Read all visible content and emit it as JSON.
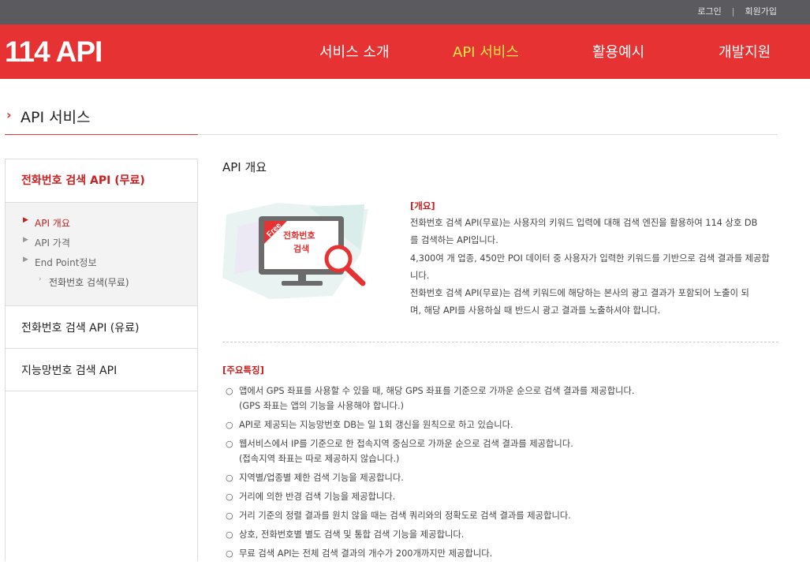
{
  "topbar": {
    "login": "로그인",
    "signup": "회원가입"
  },
  "header": {
    "logo": "114 API",
    "nav": [
      "서비스 소개",
      "API 서비스",
      "활용예시",
      "개발지원"
    ],
    "active_index": 1
  },
  "page_title": "API 서비스",
  "sidebar": {
    "head": "전화번호 검색 API (무료)",
    "sub_items": [
      "API 개요",
      "API 가격",
      "End Point정보",
      "전화번호 검색(무료)"
    ],
    "items": [
      "전화번호 검색 API (유료)",
      "지능망번호 검색 API"
    ]
  },
  "main": {
    "section_title": "API 개요",
    "illustration": {
      "badge": "Free",
      "line1": "전화번호",
      "line2": "검색"
    },
    "overview_tag": "[개요]",
    "overview_lines": [
      "전화번호 검색 API(무료)는 사용자의 키워드 입력에 대해 검색 엔진을 활용하여 114 상호 DB",
      "를 검색하는 API입니다.",
      "4,300여 개 업종, 450만 POI 데이터 중 사용자가 입력한 키워드를 기반으로 검색 결과를 제공합",
      "니다.",
      "전화번호 검색 API(무료)는 검색 키워드에 해당하는 본사의 광고 결과가 포함되어 노출이 되",
      "며, 해당 API를 사용하실 때 반드시 광고 결과를 노출하셔야 합니다."
    ],
    "features_tag": "[주요특징]",
    "features": [
      {
        "text": "앱에서 GPS 좌표를 사용할 수 있을 때, 해당 GPS 좌표를 기준으로 가까운 순으로 검색 결과를 제공합니다.",
        "sub": "(GPS 좌표는 앱의 기능을 사용해야 합니다.)"
      },
      {
        "text": "API로 제공되는 지능망번호 DB는 일 1회 갱신을 원칙으로 하고 있습니다.",
        "sub": ""
      },
      {
        "text": "웹서비스에서 IP를 기준으로 한 접속지역 중심으로 가까운 순으로 검색 결과를 제공합니다.",
        "sub": "(접속지역 좌표는 따로 제공하지 않습니다.)"
      },
      {
        "text": "지역별/업종별 제한 검색 기능을 제공합니다.",
        "sub": ""
      },
      {
        "text": "거리에 의한 반경 검색 기능을 제공합니다.",
        "sub": ""
      },
      {
        "text": "거리 기준의 정렬 결과를 원치 않을 때는 검색 쿼리와의 정확도로 검색 결과를 제공합니다.",
        "sub": ""
      },
      {
        "text": "상호, 전화번호별 별도 검색 및 통합 검색 기능을 제공합니다.",
        "sub": ""
      },
      {
        "text": "무료 검색 API는 전체 검색 결과의 개수가 200개까지만 제공합니다.",
        "sub": ""
      }
    ],
    "bullet_symbol": "○"
  },
  "colors": {
    "brand_red": "#e63232",
    "accent_red": "#c82020",
    "nav_active": "#ffe94a",
    "topbar": "#5a5a5f"
  }
}
